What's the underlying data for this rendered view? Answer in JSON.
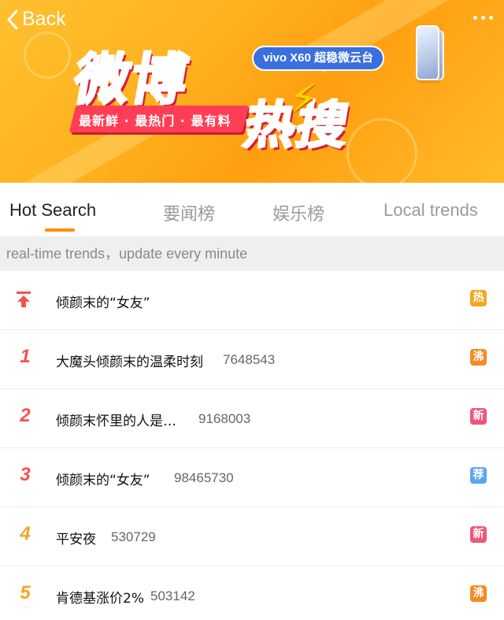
{
  "header": {
    "back_label": "Back",
    "banner": {
      "title_line1": "微博",
      "title_line2": "热搜",
      "tagline": "最新鲜 · 最热门 · 最有料",
      "sponsor_text": "vivo X60 超稳微云台"
    }
  },
  "tabs": [
    {
      "label": "Hot Search",
      "active": true
    },
    {
      "label": "要闻榜",
      "active": false
    },
    {
      "label": "娱乐榜",
      "active": false
    },
    {
      "label": "Local trends",
      "active": false
    }
  ],
  "info_bar": {
    "text": "real-time trends，update every minute"
  },
  "list": [
    {
      "rank": "",
      "pinned": true,
      "title": "倾颜末的“女友”",
      "count": "",
      "badge": "热",
      "badge_color": "#f5a623"
    },
    {
      "rank": "1",
      "pinned": false,
      "title": "大魔头倾颜末的温柔时刻",
      "count": "7648543",
      "badge": "沸",
      "badge_color": "#f58a23"
    },
    {
      "rank": "2",
      "pinned": false,
      "title": "倾颜末怀里的人是…",
      "count": "9168003",
      "badge": "新",
      "badge_color": "#f2547a"
    },
    {
      "rank": "3",
      "pinned": false,
      "title": "倾颜末的“女友”",
      "count": "98465730",
      "badge": "荐",
      "badge_color": "#5aa7f0"
    },
    {
      "rank": "4",
      "pinned": false,
      "title": "平安夜",
      "count": "530729",
      "badge": "新",
      "badge_color": "#f2547a"
    },
    {
      "rank": "5",
      "pinned": false,
      "title": "肯德基涨价2%",
      "count": "503142",
      "badge": "沸",
      "badge_color": "#f58a23"
    }
  ],
  "colors": {
    "accent_orange": "#ff8a00",
    "rank_red": "#f2544c",
    "rank_orange": "#f5a623"
  },
  "icons": {
    "back": "chevron-left-icon",
    "more": "more-dots-icon",
    "pin": "pin-top-icon"
  }
}
